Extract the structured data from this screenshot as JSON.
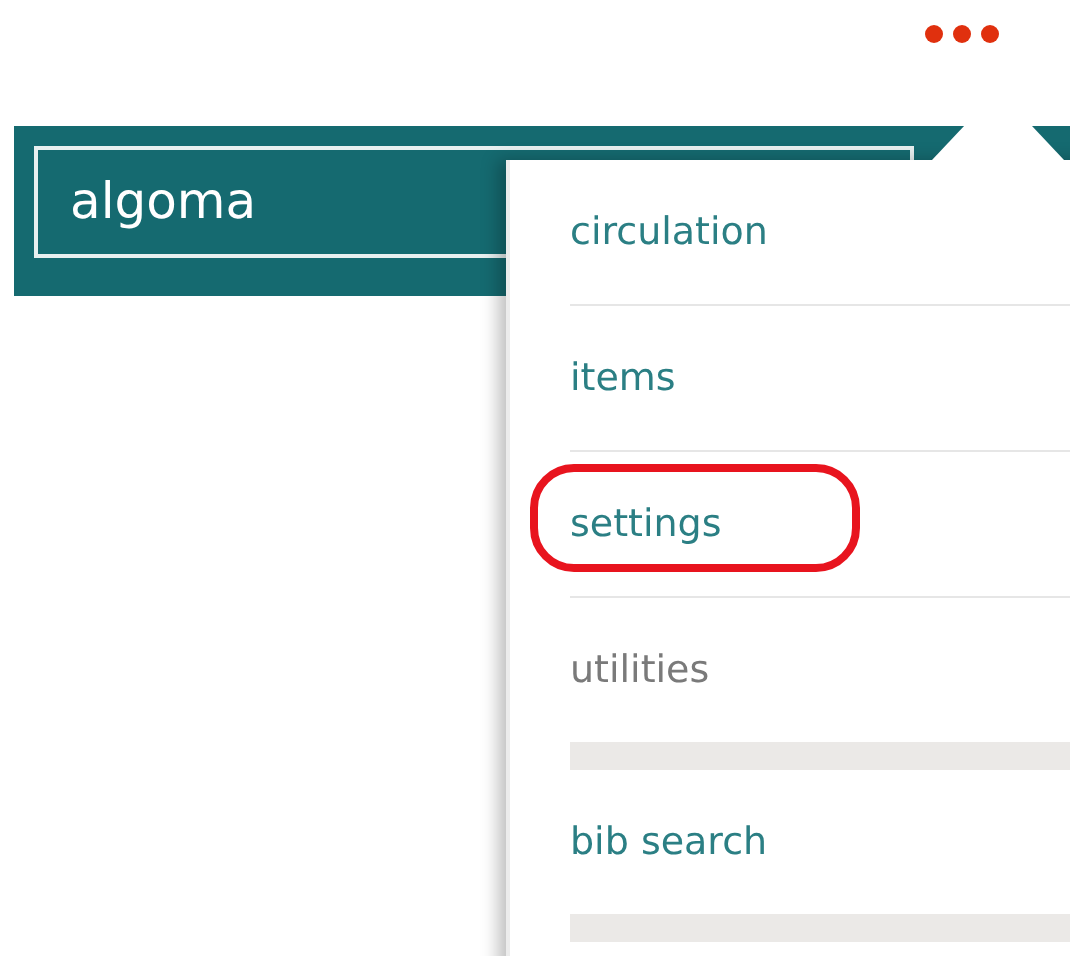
{
  "search": {
    "value": "algoma"
  },
  "menu": {
    "items": [
      {
        "label": "circulation",
        "disabled": false,
        "annotated": false,
        "kind": "ruled"
      },
      {
        "label": "items",
        "disabled": false,
        "annotated": false,
        "kind": "ruled"
      },
      {
        "label": "settings",
        "disabled": false,
        "annotated": true,
        "kind": "ruled"
      },
      {
        "label": "utilities",
        "disabled": true,
        "annotated": false,
        "kind": "skeleton"
      },
      {
        "label": "bib search",
        "disabled": false,
        "annotated": false,
        "kind": "skeleton"
      }
    ]
  }
}
